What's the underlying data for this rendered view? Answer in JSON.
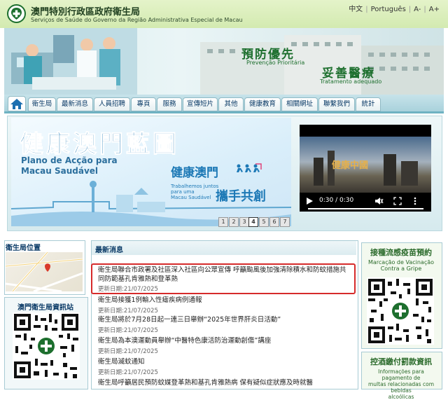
{
  "header": {
    "title_zh": "澳門特別行政區政府衛生局",
    "title_pt": "Serviços de Saúde do Governo da Região Administrativa Especial de Macau",
    "languages": [
      "中文",
      "Português"
    ],
    "font_small": "A-",
    "font_large": "A+"
  },
  "banner": {
    "slogan1": "預防優先",
    "slogan1_pt": "Prevenção Prioritária",
    "slogan2": "妥善醫療",
    "slogan2_pt": "Tratamento adequado"
  },
  "nav": {
    "home_icon": "home-icon",
    "items": [
      "衛生局",
      "最新消息",
      "人員招聘",
      "專頁",
      "服務",
      "宣傳短片",
      "其他",
      "健康教育",
      "相關網址",
      "聯繫我們",
      "統計"
    ]
  },
  "hero": {
    "title": "健康澳門藍圖",
    "subtitle_line1": "Plano de Acção para",
    "subtitle_line2": "Macau Saudável",
    "logo_zh": "健康澳門",
    "logo_pt_line1": "Trabalhemos juntos",
    "logo_pt_line2": "para uma",
    "logo_pt_line3": "Macau Saudável",
    "logo_zh2": "攜手共創",
    "pages": [
      "1",
      "2",
      "3",
      "4",
      "5",
      "6",
      "7"
    ],
    "active_page": "4"
  },
  "video": {
    "time": "0:30 / 0:30",
    "progress": 1.0
  },
  "left": {
    "map_title": "衛生局位置",
    "news_app_title": "澳門衛生局資訊站"
  },
  "news": {
    "heading": "最新消息",
    "items": [
      {
        "title": "衛生局聯合市政署及社區深入社區向公眾宣傳 呼籲颱風後加強清除積水和防蚊措施共同防範基孔肯雅熱和登革熱",
        "date": "更新日期:21/07/2025"
      },
      {
        "title": "衛生局接獲1例輸入性瘧疾病例通報",
        "date": "更新日期:21/07/2025"
      },
      {
        "title": "衛生局將於7月28日起一連三日舉辦“2025年世界肝炎日活動”",
        "date": "更新日期:21/07/2025"
      },
      {
        "title": "衛生局為本澳運動員舉辦“中醫特色康活防治運動創傷”講座",
        "date": "更新日期:21/07/2025"
      },
      {
        "title": "衛生局滅蚊通知",
        "date": "更新日期:21/07/2025"
      },
      {
        "title": "衛生局呼籲居民預防蚊媒登革熱和基孔肯雅熱病 保有疑似症狀應及時就醫",
        "date": ""
      }
    ]
  },
  "right": {
    "vacc_title": "接種流感疫苗預約",
    "vacc_pt_line1": "Marcação de Vacinação",
    "vacc_pt_line2": "Contra a Gripe",
    "tobacco_title": "控酒繳付罰款資訊",
    "tobacco_pt_line1": "Informações para pagamento de",
    "tobacco_pt_line2": "multas relacionadas com bebidas",
    "tobacco_pt_line3": "alcoólicas"
  },
  "colors": {
    "header_bg": "#d3eab0",
    "brand_green": "#1d6f2e",
    "nav_blue": "#0b3b67",
    "highlight_red": "#d62b2b"
  }
}
